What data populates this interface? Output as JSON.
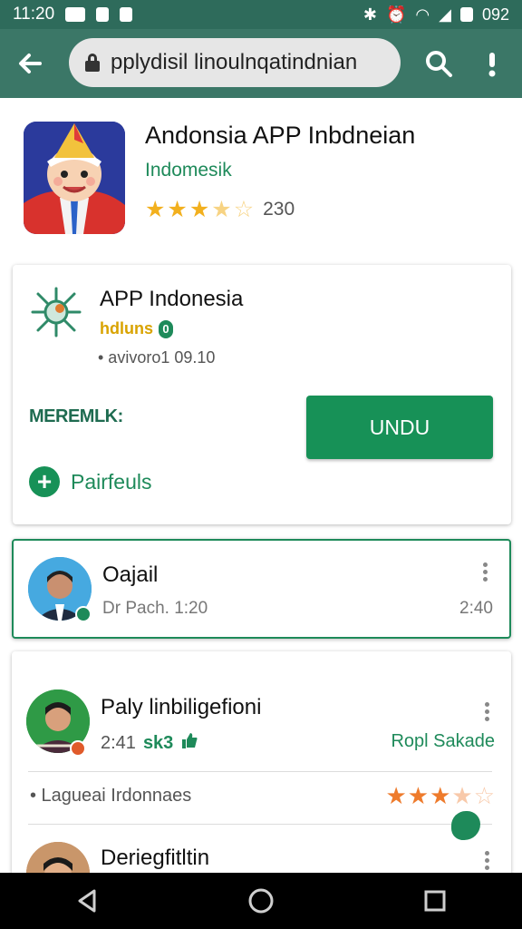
{
  "status_bar": {
    "time": "11:20",
    "battery_text": "092"
  },
  "toolbar": {
    "url_text": "pplydisil linoulnqatindnian"
  },
  "app": {
    "title": "Andonsia APP Inbdneian",
    "developer": "Indomesik",
    "rating": 3.5,
    "rating_count": "230"
  },
  "card1": {
    "title": "APP Indonesia",
    "subtitle": "hdluns",
    "badge": "0",
    "meta": "• avivoro1 09.10",
    "label": "MEREMLK:",
    "install_label": "UNDU",
    "add_label": "Pairfeuls"
  },
  "list": [
    {
      "name": "Oajail",
      "subtitle": "Dr Pach. 1:20",
      "time": "2:40"
    },
    {
      "name": "Paly linbiligefioni",
      "time": "2:41",
      "tag": "sk3",
      "link": "Ropl Sakade"
    },
    {
      "name": "Deriegfitltin"
    }
  ],
  "row": {
    "label": "• Lagueai Irdonnaes",
    "rating": 3.5
  },
  "colors": {
    "primary": "#3b7767",
    "accent": "#179157",
    "star": "#f2b01e",
    "star_alt": "#ee7b2c"
  }
}
